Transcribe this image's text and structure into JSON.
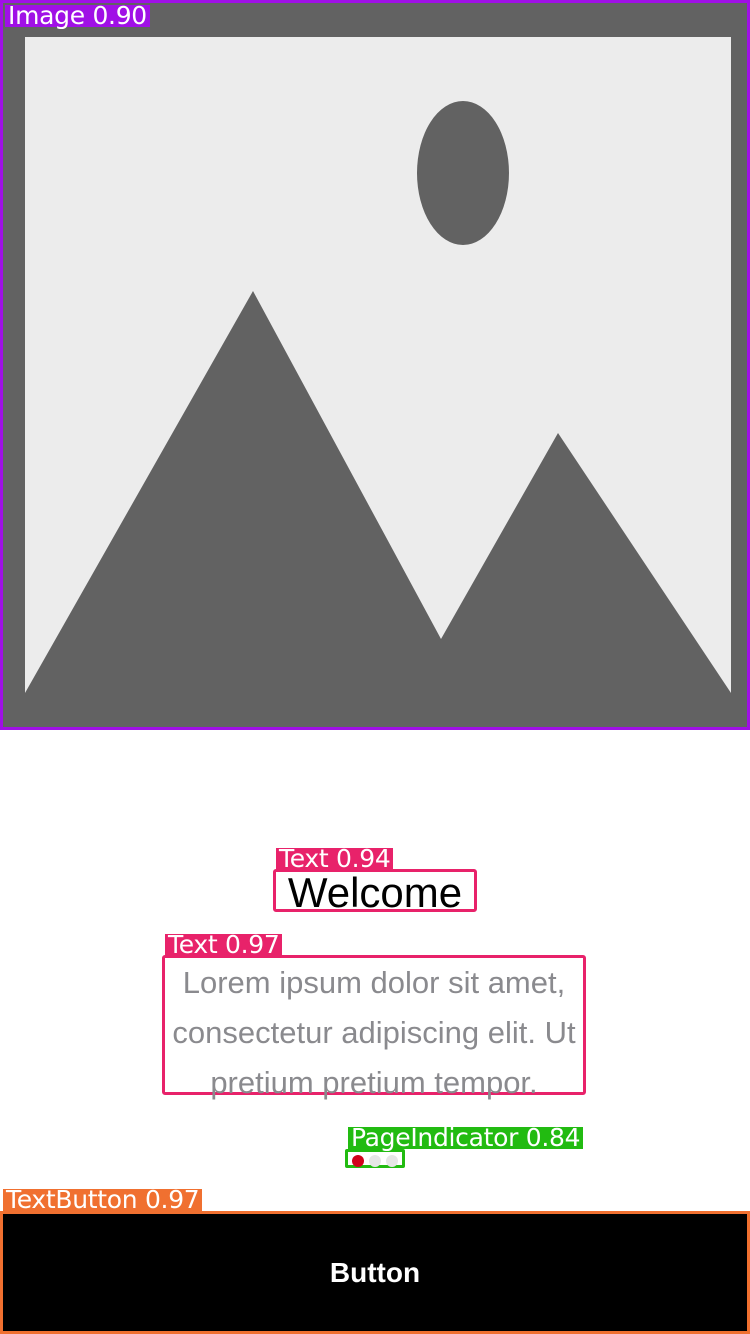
{
  "detections": {
    "image_label": "Image 0.90",
    "title_label": "Text 0.94",
    "body_label": "Text 0.97",
    "pager_label": "PageIndicator 0.84",
    "button_label": "TextButton 0.97"
  },
  "content": {
    "title": "Welcome",
    "body": "Lorem ipsum dolor sit amet, consectetur adipiscing elit. Ut pretium pretium tempor.",
    "button": "Button"
  },
  "page_indicator": {
    "pages": 3,
    "active_index": 0,
    "active_color": "#d0021b",
    "inactive_color": "#e6e6e6"
  },
  "colors": {
    "image_box": "#a010e6",
    "text_box": "#e8226a",
    "pager_box": "#22bb11",
    "button_box": "#f07030",
    "placeholder_bg": "#ececec",
    "placeholder_shape": "#626262"
  },
  "icons": {
    "image": "image-placeholder-icon"
  }
}
